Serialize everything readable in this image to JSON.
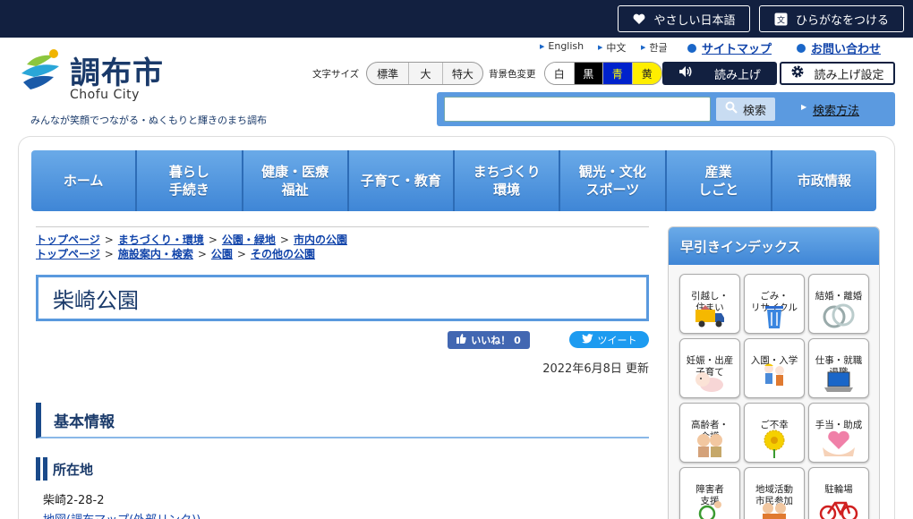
{
  "topbar": {
    "easy_japanese": "やさしい日本語",
    "furigana": "ひらがなをつける"
  },
  "logo": {
    "name": "調布市",
    "romaji": "Chofu City",
    "tagline": "みんなが笑顔でつながる・ぬくもりと輝きのまち調布"
  },
  "util": {
    "english": "English",
    "chinese": "中文",
    "korean": "한글",
    "sitemap": "サイトマップ",
    "contact": "お問い合わせ"
  },
  "controls": {
    "font_size_label": "文字サイズ",
    "font_sizes": [
      "標準",
      "大",
      "特大"
    ],
    "bg_label": "背景色変更",
    "bg_colors": [
      "白",
      "黒",
      "青",
      "黄"
    ],
    "read_aloud": "読み上げ",
    "read_settings": "読み上げ設定"
  },
  "search": {
    "placeholder": "",
    "button": "検索",
    "how": "検索方法"
  },
  "gnav": [
    "ホーム",
    "暮らし\n手続き",
    "健康・医療\n福祉",
    "子育て・教育",
    "まちづくり\n環境",
    "観光・文化\nスポーツ",
    "産業\nしごと",
    "市政情報"
  ],
  "breadcrumbs": [
    [
      "トップページ",
      "まちづくり・環境",
      "公園・緑地",
      "市内の公園"
    ],
    [
      "トップページ",
      "施設案内・検索",
      "公園",
      "その他の公園"
    ]
  ],
  "page": {
    "title": "柴崎公園",
    "like": "いいね！ 0",
    "tweet": "ツイート",
    "updated": "2022年6月8日 更新",
    "section": "基本情報",
    "location_heading": "所在地",
    "address": "柴崎2-28-2",
    "map_link": "地図(調布マップ(外部リンク))"
  },
  "index": {
    "title": "早引きインデックス",
    "tiles": [
      "引越し・\n住まい",
      "ごみ・\nリサイクル",
      "結婚・離婚",
      "妊娠・出産\n子育て",
      "入園・入学",
      "仕事・就職\n退職",
      "高齢者・\n介護",
      "ご不幸",
      "手当・助成",
      "障害者\n支援",
      "地域活動\n市民参加",
      "駐輪場"
    ]
  },
  "colors": {
    "topbar": "#122040",
    "nav": "#3f86d6",
    "accent": "#1a4a8a"
  }
}
